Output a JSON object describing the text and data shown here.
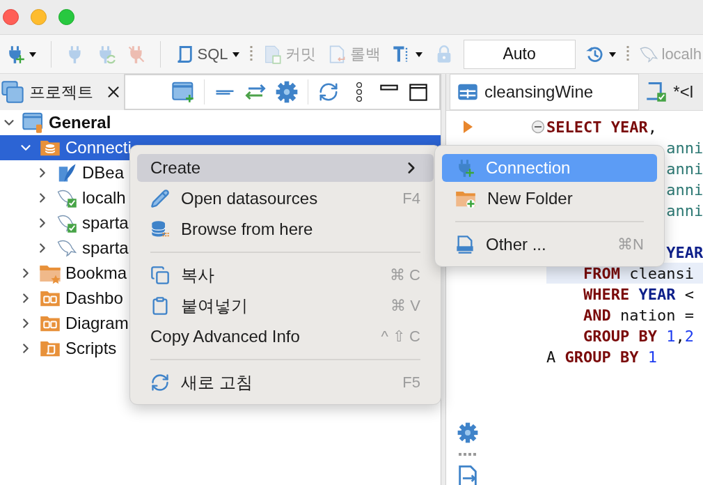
{
  "toolbar": {
    "items": [
      {
        "kind": "icon",
        "dropdown": true,
        "disabled": false
      },
      {
        "kind": "separator"
      },
      {
        "kind": "icon",
        "dropdown": false,
        "disabled": true
      },
      {
        "kind": "icon",
        "dropdown": false,
        "disabled": true
      },
      {
        "kind": "icon",
        "dropdown": false,
        "disabled": true
      },
      {
        "kind": "separator"
      },
      {
        "kind": "labeled",
        "label": "SQL",
        "dropdown": true,
        "disabled": false
      },
      {
        "kind": "grip"
      },
      {
        "kind": "labeled",
        "label": "커밋",
        "dropdown": false,
        "disabled": true
      },
      {
        "kind": "labeled",
        "label": "롤백",
        "dropdown": false,
        "disabled": true
      },
      {
        "kind": "icon",
        "dropdown": true,
        "disabled": false
      },
      {
        "kind": "icon",
        "dropdown": false,
        "disabled": true
      },
      {
        "kind": "field",
        "value": "Auto"
      },
      {
        "kind": "icon",
        "dropdown": true,
        "disabled": false
      },
      {
        "kind": "grip"
      },
      {
        "kind": "labeled",
        "label": "localh",
        "dropdown": false,
        "disabled": true
      }
    ]
  },
  "project_panel": {
    "tab": {
      "label": "프로젝트",
      "selected": true
    },
    "tree": [
      {
        "label": "General",
        "kind": "project",
        "expanded": true,
        "selected": false,
        "children": [
          {
            "label": "Connecti",
            "kind": "connections",
            "expanded": true,
            "selected": true,
            "children": [
              {
                "label": "DBea",
                "kind": "sqlite",
                "expanded": false,
                "selected": false
              },
              {
                "label": "localh",
                "kind": "mysql",
                "connected": true,
                "expanded": false,
                "selected": false
              },
              {
                "label": "sparta",
                "kind": "mysql",
                "connected": true,
                "expanded": false,
                "selected": false
              },
              {
                "label": "sparta",
                "kind": "mysql",
                "connected": false,
                "expanded": false,
                "selected": false
              }
            ]
          },
          {
            "label": "Bookma",
            "kind": "bookmarks",
            "expanded": false,
            "selected": false
          },
          {
            "label": "Dashbo",
            "kind": "dashboards",
            "expanded": false,
            "selected": false
          },
          {
            "label": "Diagram",
            "kind": "diagrams",
            "expanded": false,
            "selected": false
          },
          {
            "label": "Scripts",
            "kind": "scripts",
            "expanded": false,
            "selected": false
          }
        ]
      }
    ]
  },
  "editor": {
    "tabs": [
      {
        "label": "cleansingWine",
        "kind": "table",
        "selected": true
      },
      {
        "label": "*<l",
        "kind": "script",
        "selected": false
      }
    ],
    "lines": [
      {
        "marker": true,
        "fold": true,
        "current": false,
        "tokens": [
          {
            "kind": "keyword",
            "text": "SELECT YEAR"
          },
          {
            "kind": "plain",
            "text": ","
          }
        ]
      },
      {
        "marker": false,
        "fold": false,
        "current": false,
        "tokens": [
          {
            "kind": "field",
            "text": "             anni"
          }
        ]
      },
      {
        "marker": false,
        "fold": false,
        "current": false,
        "tokens": [
          {
            "kind": "field",
            "text": "             anni"
          }
        ]
      },
      {
        "marker": false,
        "fold": false,
        "current": false,
        "tokens": [
          {
            "kind": "field",
            "text": "             anni"
          }
        ]
      },
      {
        "marker": false,
        "fold": false,
        "current": false,
        "tokens": [
          {
            "kind": "field",
            "text": "             anni"
          }
        ]
      },
      {
        "marker": false,
        "fold": false,
        "current": false
      },
      {
        "marker": false,
        "fold": false,
        "current": false,
        "tokens": [
          {
            "kind": "builtin",
            "text": "             YEAR"
          }
        ]
      },
      {
        "marker": false,
        "fold": false,
        "current": true,
        "tokens": [
          {
            "kind": "keyword",
            "text": "    FROM"
          },
          {
            "kind": "plain",
            "text": " cleansi"
          }
        ]
      },
      {
        "marker": false,
        "fold": false,
        "current": false,
        "tokens": [
          {
            "kind": "keyword",
            "text": "    WHERE"
          },
          {
            "kind": "builtin",
            "text": " YEAR"
          },
          {
            "kind": "plain",
            "text": " <"
          }
        ]
      },
      {
        "marker": false,
        "fold": false,
        "current": false,
        "tokens": [
          {
            "kind": "keyword",
            "text": "    AND"
          },
          {
            "kind": "plain",
            "text": " nation ="
          }
        ]
      },
      {
        "marker": false,
        "fold": false,
        "current": false,
        "tokens": [
          {
            "kind": "keyword",
            "text": "    GROUP BY"
          },
          {
            "kind": "number",
            "text": " 1"
          },
          {
            "kind": "plain",
            "text": ","
          },
          {
            "kind": "number",
            "text": "2"
          }
        ]
      },
      {
        "marker": false,
        "fold": false,
        "current": false,
        "tokens": [
          {
            "kind": "plain",
            "text": "A"
          },
          {
            "kind": "keyword",
            "text": " GROUP BY"
          },
          {
            "kind": "number",
            "text": " 1"
          }
        ]
      }
    ]
  },
  "context_menu": {
    "items": [
      {
        "kind": "item",
        "label": "Create",
        "selected": true,
        "submenu": true
      },
      {
        "kind": "item",
        "label": "Open datasources",
        "shortcut": "F4",
        "selected": false,
        "submenu": false
      },
      {
        "kind": "item",
        "label": "Browse from here",
        "selected": false,
        "submenu": false
      },
      {
        "kind": "separator"
      },
      {
        "kind": "item",
        "label": "복사",
        "shortcut": "⌘ C",
        "selected": false,
        "submenu": false
      },
      {
        "kind": "item",
        "label": "붙여넣기",
        "shortcut": "⌘ V",
        "selected": false,
        "submenu": false
      },
      {
        "kind": "item",
        "label": "Copy Advanced Info",
        "shortcut": "^ ⇧ C",
        "selected": false,
        "submenu": false
      },
      {
        "kind": "separator"
      },
      {
        "kind": "item",
        "label": "새로 고침",
        "shortcut": "F5",
        "selected": false,
        "submenu": false
      }
    ]
  },
  "submenu": {
    "items": [
      {
        "kind": "item",
        "label": "Connection",
        "selected": true
      },
      {
        "kind": "item",
        "label": "New Folder",
        "selected": false
      },
      {
        "kind": "separator"
      },
      {
        "kind": "item",
        "label": "Other ...",
        "shortcut": "⌘N",
        "selected": false
      }
    ]
  }
}
